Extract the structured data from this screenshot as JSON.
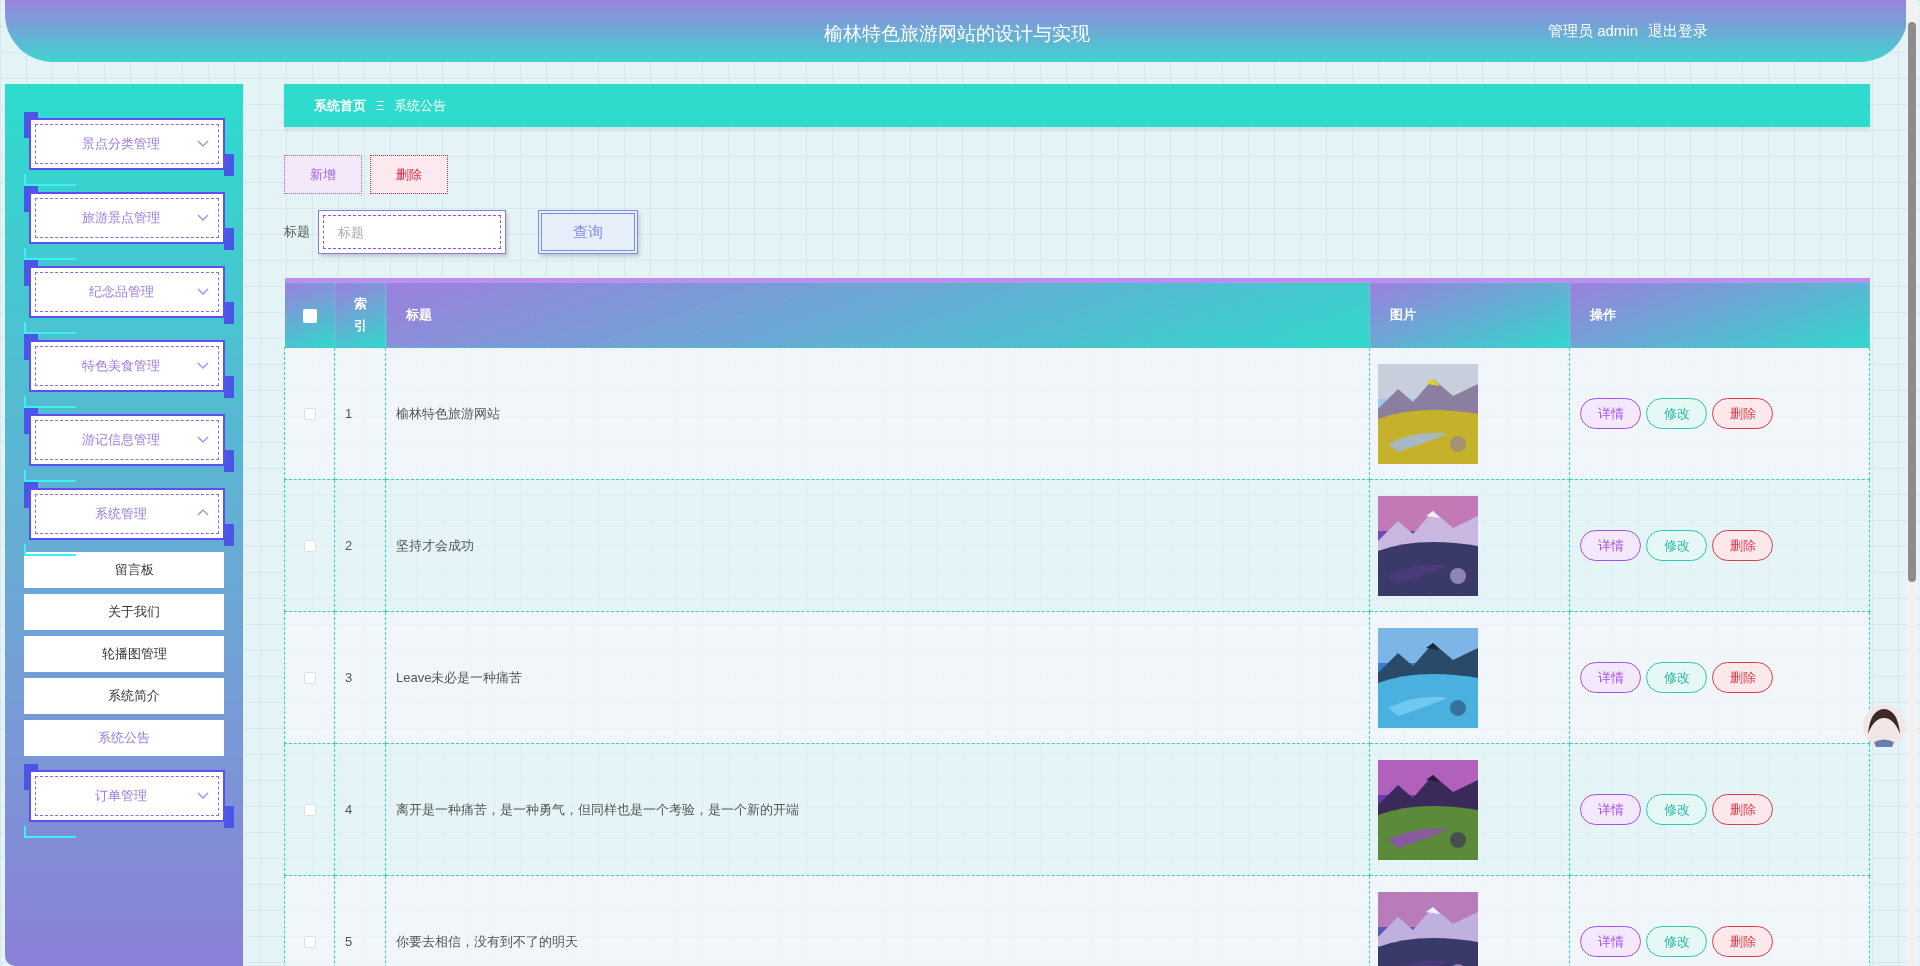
{
  "header": {
    "title": "榆林特色旅游网站的设计与实现",
    "user": "管理员 admin",
    "logout": "退出登录"
  },
  "sidebar": {
    "menu": [
      {
        "label": "景点分类管理",
        "expanded": false
      },
      {
        "label": "旅游景点管理",
        "expanded": false
      },
      {
        "label": "纪念品管理",
        "expanded": false
      },
      {
        "label": "特色美食管理",
        "expanded": false
      },
      {
        "label": "游记信息管理",
        "expanded": false
      },
      {
        "label": "系统管理",
        "expanded": true,
        "children": [
          {
            "label": "留言板",
            "selected": false
          },
          {
            "label": "关于我们",
            "selected": false
          },
          {
            "label": "轮播图管理",
            "selected": false
          },
          {
            "label": "系统简介",
            "selected": false
          },
          {
            "label": "系统公告",
            "selected": true
          }
        ]
      },
      {
        "label": "订单管理",
        "expanded": false
      }
    ]
  },
  "breadcrumb": [
    {
      "label": "系统首页"
    },
    {
      "label": "系统公告"
    }
  ],
  "breadcrumb_separator": "Ξ",
  "toolbar": [
    {
      "label": "新增",
      "kind": "add"
    },
    {
      "label": "删除",
      "kind": "delete"
    }
  ],
  "search": {
    "label": "标题",
    "placeholder": "标题",
    "button": "查询"
  },
  "table": {
    "select_all": false,
    "columns": [
      "索引",
      "标题",
      "图片",
      "操作"
    ],
    "rows": [
      {
        "checked": false,
        "index": "1",
        "title": "榆林特色旅游网站",
        "image": {
          "kind": "picture"
        },
        "actions": [
          {
            "label": "详情",
            "kind": "detail"
          },
          {
            "label": "修改",
            "kind": "edit"
          },
          {
            "label": "删除",
            "kind": "delete"
          }
        ]
      },
      {
        "checked": false,
        "index": "2",
        "title": "坚持才会成功",
        "image": {
          "kind": "picture"
        },
        "actions": [
          {
            "label": "详情",
            "kind": "detail"
          },
          {
            "label": "修改",
            "kind": "edit"
          },
          {
            "label": "删除",
            "kind": "delete"
          }
        ]
      },
      {
        "checked": false,
        "index": "3",
        "title": "Leave未必是一种痛苦",
        "image": {
          "kind": "picture"
        },
        "actions": [
          {
            "label": "详情",
            "kind": "detail"
          },
          {
            "label": "修改",
            "kind": "edit"
          },
          {
            "label": "删除",
            "kind": "delete"
          }
        ]
      },
      {
        "checked": false,
        "index": "4",
        "title": "离开是一种痛苦，是一种勇气，但同样也是一个考验，是一个新的开端",
        "image": {
          "kind": "picture"
        },
        "actions": [
          {
            "label": "详情",
            "kind": "detail"
          },
          {
            "label": "修改",
            "kind": "edit"
          },
          {
            "label": "删除",
            "kind": "delete"
          }
        ]
      },
      {
        "checked": false,
        "index": "5",
        "title": "你要去相信，没有到不了的明天",
        "image": {
          "kind": "picture"
        },
        "actions": [
          {
            "label": "详情",
            "kind": "detail"
          },
          {
            "label": "修改",
            "kind": "edit"
          },
          {
            "label": "删除",
            "kind": "delete"
          }
        ]
      }
    ]
  }
}
